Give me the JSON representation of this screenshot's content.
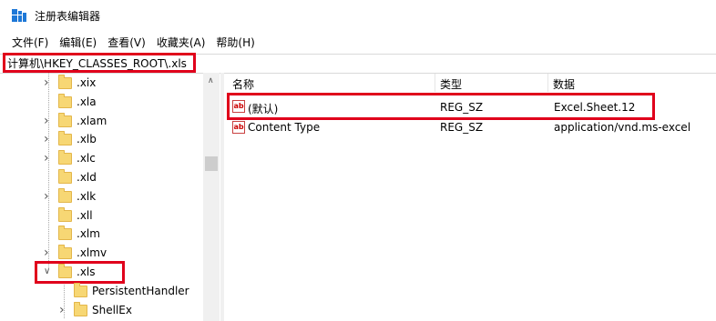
{
  "window": {
    "title": "注册表编辑器",
    "icon": "regedit-icon"
  },
  "menu": [
    "文件(F)",
    "编辑(E)",
    "查看(V)",
    "收藏夹(A)",
    "帮助(H)"
  ],
  "address": "计算机\\HKEY_CLASSES_ROOT\\.xls",
  "tree": {
    "items": [
      {
        "label": ".xix",
        "expander": "collapsed"
      },
      {
        "label": ".xla",
        "expander": "none"
      },
      {
        "label": ".xlam",
        "expander": "collapsed"
      },
      {
        "label": ".xlb",
        "expander": "collapsed"
      },
      {
        "label": ".xlc",
        "expander": "collapsed"
      },
      {
        "label": ".xld",
        "expander": "none"
      },
      {
        "label": ".xlk",
        "expander": "collapsed"
      },
      {
        "label": ".xll",
        "expander": "none"
      },
      {
        "label": ".xlm",
        "expander": "none"
      },
      {
        "label": ".xlmv",
        "expander": "collapsed"
      },
      {
        "label": ".xls",
        "expander": "expanded",
        "selected": true
      },
      {
        "label": "PersistentHandler",
        "expander": "none",
        "child": true
      },
      {
        "label": "ShellEx",
        "expander": "collapsed",
        "child": true
      }
    ]
  },
  "list": {
    "columns": [
      "名称",
      "类型",
      "数据"
    ],
    "rows": [
      {
        "name": "(默认)",
        "type": "REG_SZ",
        "data": "Excel.Sheet.12",
        "highlighted": true
      },
      {
        "name": "Content Type",
        "type": "REG_SZ",
        "data": "application/vnd.ms-excel"
      }
    ]
  },
  "colors": {
    "highlight": "#e0001b",
    "folder": "#f7d774"
  }
}
